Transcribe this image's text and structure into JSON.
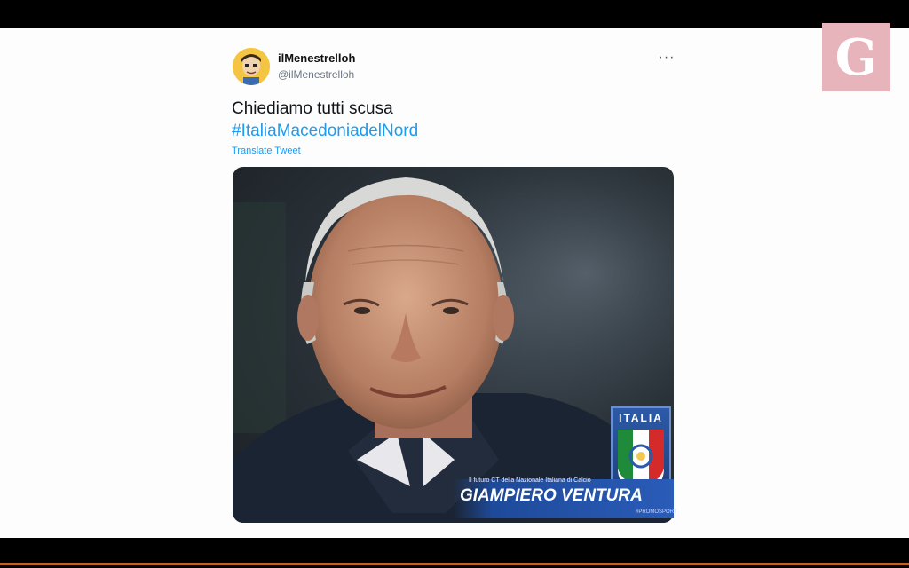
{
  "tweet": {
    "display_name": "ilMenestrelloh",
    "handle": "@ilMenestrelloh",
    "more_label": "···",
    "text": "Chiediamo tutti scusa",
    "hashtag": "#ItaliaMacedoniadelNord",
    "translate_label": "Translate Tweet"
  },
  "media": {
    "badge_title": "ITALIA",
    "caption_subtitle": "Il futuro CT della Nazionale Italiana di Calcio",
    "caption_name": "GIAMPIERO VENTURA",
    "caption_tag": "#PROMOSPORT"
  },
  "brand": {
    "logo_letter": "G",
    "logo_color": "#e8b4bc",
    "link_color": "#1d9bf0"
  }
}
